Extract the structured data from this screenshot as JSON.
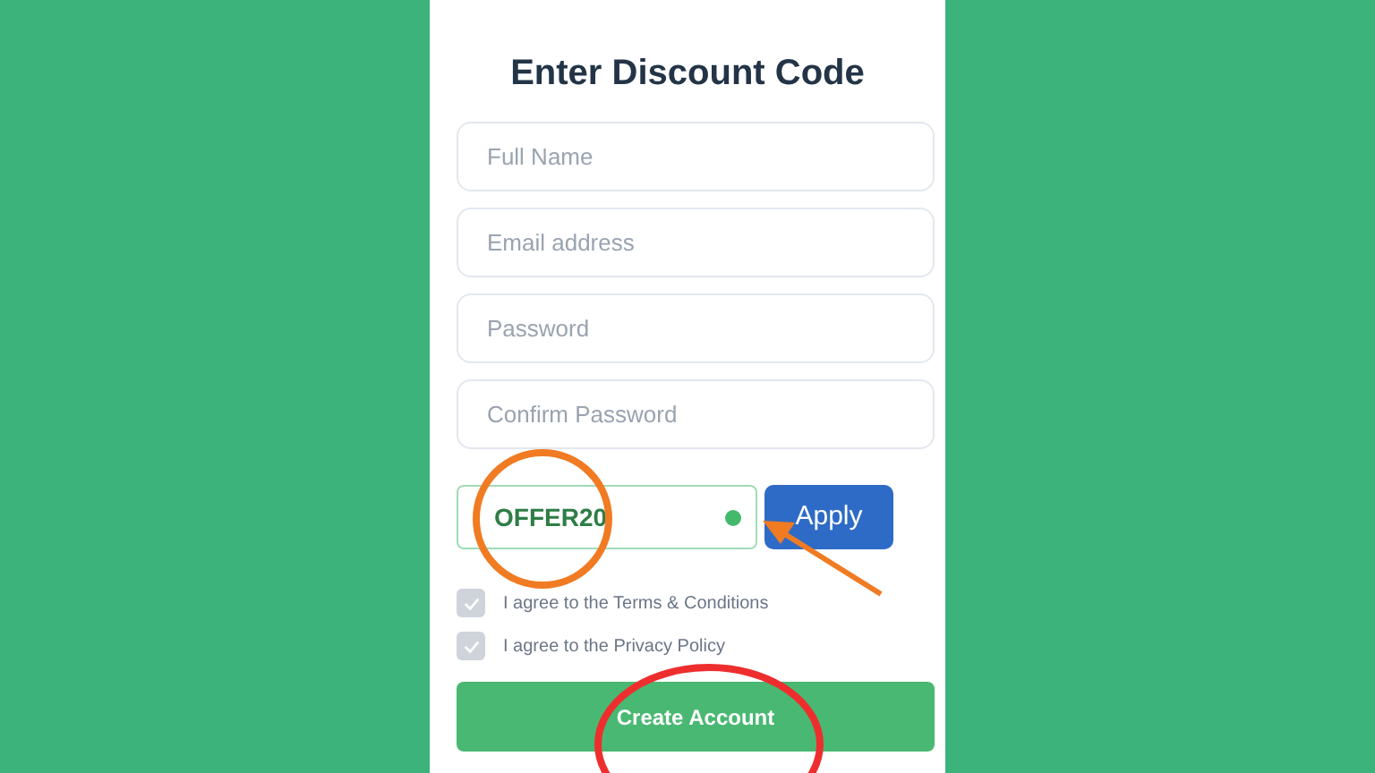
{
  "title": "Enter Discount Code",
  "fields": [
    {
      "placeholder": "Full Name"
    },
    {
      "placeholder": "Email address"
    },
    {
      "placeholder": "Password"
    },
    {
      "placeholder": "Confirm Password"
    }
  ],
  "discount": {
    "value": "OFFER20",
    "valid": true,
    "button": "Apply"
  },
  "agreements": [
    {
      "label": "I agree to the Terms & Conditions",
      "checked": true
    },
    {
      "label": "I agree to the Privacy Policy",
      "checked": true
    }
  ],
  "submit": "Create Account"
}
